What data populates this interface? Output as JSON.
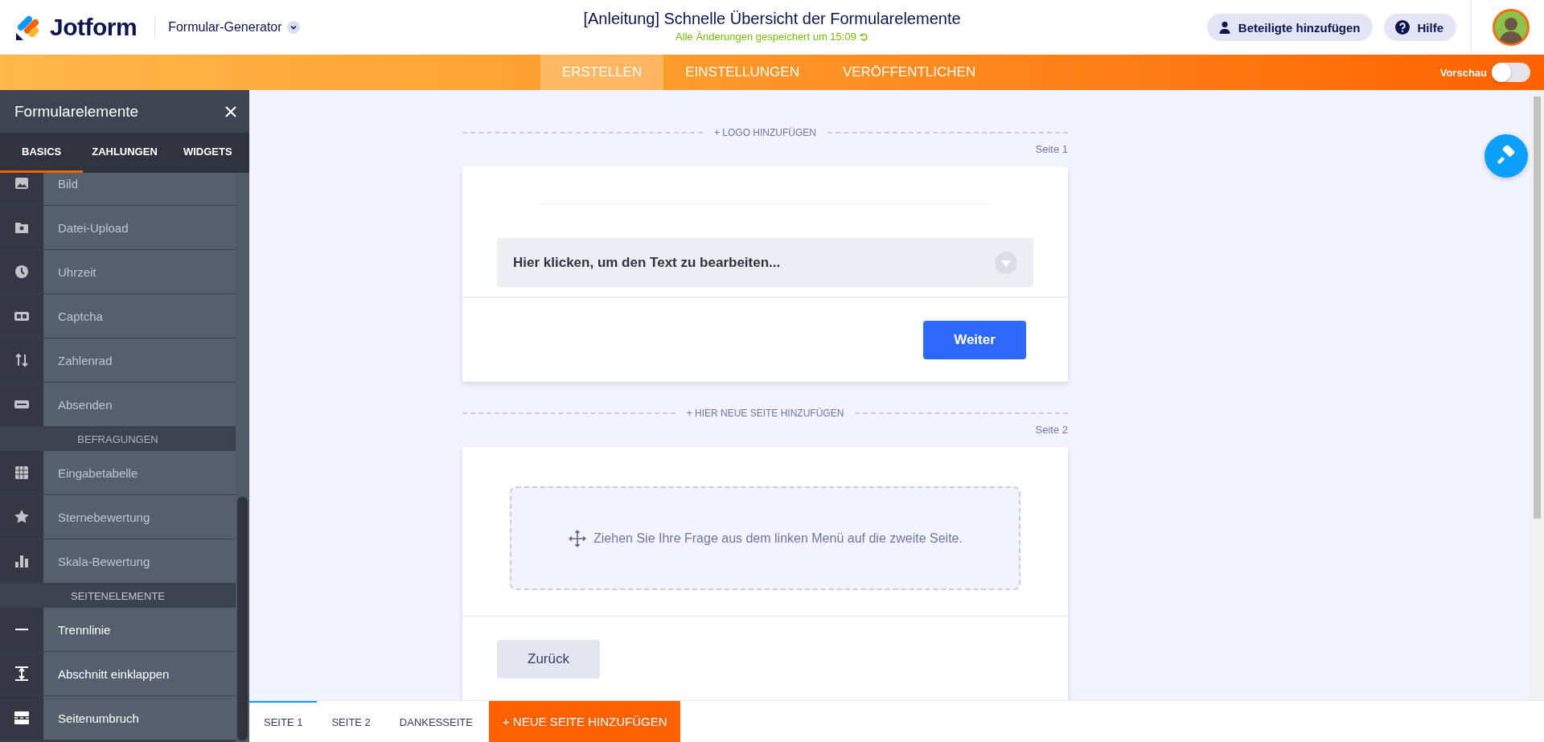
{
  "header": {
    "logo": "Jotform",
    "product": "Formular-Generator",
    "title": "[Anleitung] Schnelle Übersicht der Formularelemente",
    "saved": "Alle Änderungen gespeichert um 15:09",
    "buttons": [
      {
        "label": "Beteiligte hinzufügen",
        "kind": "invite"
      },
      {
        "label": "Hilfe",
        "kind": "help"
      }
    ]
  },
  "nav": {
    "tabs": [
      {
        "label": "ERSTELLEN",
        "selected": true
      },
      {
        "label": "EINSTELLUNGEN",
        "selected": false
      },
      {
        "label": "VERÖFFENTLICHEN",
        "selected": false
      }
    ],
    "preview": {
      "label": "Vorschau",
      "on": false
    }
  },
  "sidebar": {
    "title": "Formularelemente",
    "tabs": [
      {
        "label": "BASICS",
        "selected": true
      },
      {
        "label": "ZAHLUNGEN",
        "selected": false
      },
      {
        "label": "WIDGETS",
        "selected": false
      }
    ],
    "items": [
      {
        "kind": "element",
        "label": "Bild",
        "dimmed": true
      },
      {
        "kind": "element",
        "label": "Datei-Upload",
        "dimmed": true
      },
      {
        "kind": "element",
        "label": "Uhrzeit",
        "dimmed": true
      },
      {
        "kind": "element",
        "label": "Captcha",
        "dimmed": true
      },
      {
        "kind": "element",
        "label": "Zahlenrad",
        "dimmed": true
      },
      {
        "kind": "element",
        "label": "Absenden",
        "dimmed": true
      },
      {
        "kind": "section",
        "label": "BEFRAGUNGEN",
        "dimmed": true
      },
      {
        "kind": "element",
        "label": "Eingabetabelle",
        "dimmed": true
      },
      {
        "kind": "element",
        "label": "Sternebewertung",
        "dimmed": true
      },
      {
        "kind": "element",
        "label": "Skala-Bewertung",
        "dimmed": true
      },
      {
        "kind": "section",
        "label": "SEITENELEMENTE",
        "dimmed": false
      },
      {
        "kind": "element",
        "label": "Trennlinie",
        "dimmed": false
      },
      {
        "kind": "element",
        "label": "Abschnitt einklappen",
        "dimmed": false
      },
      {
        "kind": "element",
        "label": "Seitenumbruch",
        "dimmed": false
      }
    ]
  },
  "canvas": {
    "logo_link": "+ LOGO HINZUFÜGEN",
    "add_page_link": "+ HIER NEUE SEITE HINZUFÜGEN",
    "pages": [
      {
        "label": "Seite 1",
        "kind": "text",
        "text": "Hier klicken, um den Text zu bearbeiten...",
        "button": {
          "label": "Weiter",
          "kind": "next"
        }
      },
      {
        "label": "Seite 2",
        "kind": "dropzone",
        "text": "Ziehen Sie Ihre Frage aus dem linken Menü auf die zweite Seite.",
        "button": {
          "label": "Zurück",
          "kind": "back"
        }
      }
    ]
  },
  "page_tabs": {
    "tabs": [
      {
        "label": "SEITE 1",
        "selected": true
      },
      {
        "label": "SEITE 2",
        "selected": false
      },
      {
        "label": "DANKESSEITE",
        "selected": false
      }
    ],
    "add_button": "+ NEUE SEITE HINZUFÜGEN"
  }
}
